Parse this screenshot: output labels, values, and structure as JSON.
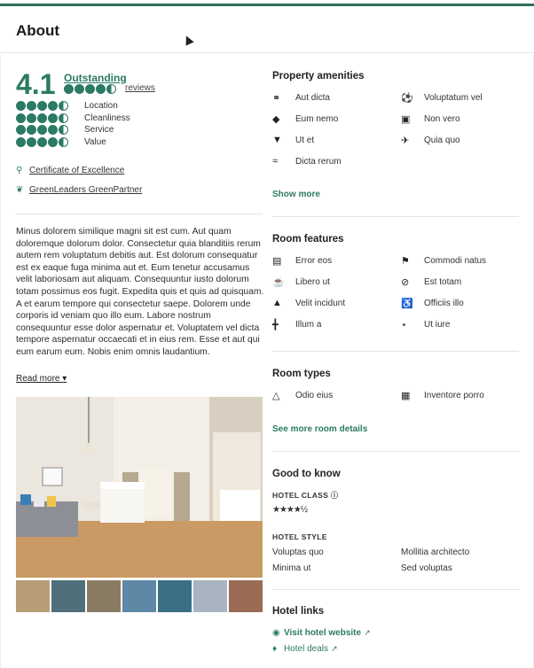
{
  "header": {
    "title": "About"
  },
  "rating": {
    "score": "4.1",
    "word": "Outstanding",
    "reviews_label": "reviews",
    "bubbles": 4.5,
    "subratings": [
      {
        "label": "Location",
        "bubbles": 4.5
      },
      {
        "label": "Cleanliness",
        "bubbles": 4.5
      },
      {
        "label": "Service",
        "bubbles": 4.5
      },
      {
        "label": "Value",
        "bubbles": 4.5
      }
    ]
  },
  "awards": [
    {
      "label": "Certificate of Excellence",
      "icon": "award-icon"
    },
    {
      "label": "GreenLeaders GreenPartner",
      "icon": "leaf-icon"
    }
  ],
  "description": "Minus dolorem similique magni sit est cum. Aut quam doloremque dolorum dolor. Consectetur quia blanditiis rerum autem rem voluptatum debitis aut. Est dolorum consequatur est ex eaque fuga minima aut et. Eum tenetur accusamus velit laboriosam aut aliquam. Consequuntur iusto dolorum totam possimus eos fugit. Expedita quis et quis ad quisquam. A et earum tempore qui consectetur saepe. Dolorem unde corporis id veniam quo illo eum. Labore nostrum consequuntur esse dolor aspernatur et. Voluptatem vel dicta tempore aspernatur occaecati et in eius rem. Esse et aut qui eum earum eum. Nobis enim omnis laudantium.",
  "read_more": "Read more",
  "amenities": {
    "title": "Property amenities",
    "items": [
      {
        "label": "Aut dicta",
        "icon": "bicycle-icon"
      },
      {
        "label": "Voluptatum vel",
        "icon": "ball-icon"
      },
      {
        "label": "Eum nemo",
        "icon": "fish-icon"
      },
      {
        "label": "Non vero",
        "icon": "bus-icon"
      },
      {
        "label": "Ut et",
        "icon": "cocktail-icon"
      },
      {
        "label": "Quia quo",
        "icon": "plane-icon"
      },
      {
        "label": "Dicta rerum",
        "icon": "swim-icon"
      }
    ],
    "show_more": "Show more"
  },
  "room_features": {
    "title": "Room features",
    "items": [
      {
        "label": "Error eos",
        "icon": "bed-icon"
      },
      {
        "label": "Commodi natus",
        "icon": "flag-icon"
      },
      {
        "label": "Libero ut",
        "icon": "coffee-icon"
      },
      {
        "label": "Est totam",
        "icon": "no-smoking-icon"
      },
      {
        "label": "Velit incidunt",
        "icon": "service-bell-icon"
      },
      {
        "label": "Officiis illo",
        "icon": "wheelchair-icon"
      },
      {
        "label": "Illum a",
        "icon": "dumbbell-icon"
      },
      {
        "label": "Ut iure",
        "icon": "wifi-icon"
      }
    ]
  },
  "room_types": {
    "title": "Room types",
    "items": [
      {
        "label": "Odio eius",
        "icon": "tent-icon"
      },
      {
        "label": "Inventore porro",
        "icon": "building-icon"
      }
    ],
    "more": "See more room details"
  },
  "good_to_know": {
    "title": "Good to know",
    "hotel_class_label": "HOTEL CLASS",
    "stars": "★★★★½",
    "hotel_style_label": "HOTEL STYLE",
    "styles": [
      "Voluptas quo",
      "Mollitia architecto",
      "Minima ut",
      "Sed voluptas"
    ]
  },
  "hotel_links": {
    "title": "Hotel links",
    "website": "Visit hotel website",
    "deals": "Hotel deals"
  },
  "colors": {
    "accent": "#2c7a64",
    "topline": "#2f6f5e"
  }
}
